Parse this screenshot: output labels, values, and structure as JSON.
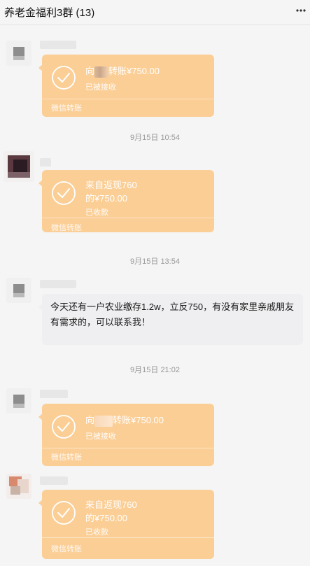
{
  "header": {
    "title": "养老金福利3群 (13)",
    "more_icon": "more-dots-icon"
  },
  "colors": {
    "transfer_card": "#fbce96",
    "text_bubble": "#efeff1",
    "background": "#f5f5f5"
  },
  "messages": [
    {
      "type": "transfer",
      "line1_prefix": "向",
      "line1_suffix": "转账¥750.00",
      "status": "已被接收",
      "brand": "微信转账"
    },
    {
      "type": "time",
      "text": "9月15日 10:54"
    },
    {
      "type": "transfer",
      "line1": "来自返现760",
      "line2": "的¥750.00",
      "status": "已收款",
      "brand": "微信转账"
    },
    {
      "type": "time",
      "text": "9月15日 13:54"
    },
    {
      "type": "text",
      "text": "今天还有一户农业缴存1.2w，立反750，有没有家里亲戚朋友有需求的，可以联系我！"
    },
    {
      "type": "time",
      "text": "9月15日 21:02"
    },
    {
      "type": "transfer",
      "line1_prefix": "向",
      "line1_suffix": "转账¥750.00",
      "status": "已被接收",
      "brand": "微信转账"
    },
    {
      "type": "transfer",
      "line1": "来自返现760",
      "line2": "的¥750.00",
      "status": "已收款",
      "brand": "微信转账"
    }
  ]
}
